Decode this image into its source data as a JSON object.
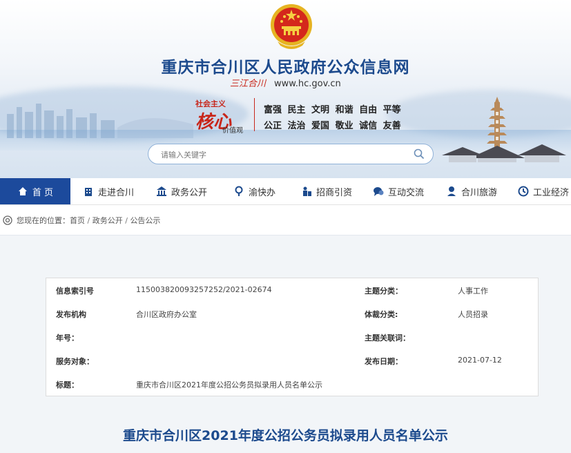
{
  "site": {
    "title": "重庆市合川区人民政府公众信息网",
    "calligraphy": "三江合川",
    "url": "www.hc.gov.cn"
  },
  "core_values": {
    "prefix": "社会主义",
    "big": "核心",
    "suffix": "价值观",
    "line1": "富强 民主 文明 和谐 自由 平等",
    "line2": "公正 法治 爱国 敬业 诚信 友善"
  },
  "search": {
    "placeholder": "请输入关键字",
    "icon": "search-icon"
  },
  "nav": {
    "items": [
      {
        "label": "首 页",
        "icon": "home-icon"
      },
      {
        "label": "走进合川",
        "icon": "building-icon"
      },
      {
        "label": "政务公开",
        "icon": "government-icon"
      },
      {
        "label": "渝快办",
        "icon": "service-icon"
      },
      {
        "label": "招商引资",
        "icon": "investment-icon"
      },
      {
        "label": "互动交流",
        "icon": "chat-icon"
      },
      {
        "label": "合川旅游",
        "icon": "travel-icon"
      },
      {
        "label": "工业经济",
        "icon": "industry-icon"
      }
    ]
  },
  "breadcrumb": {
    "prefix": "您现在的位置：",
    "items": [
      "首页",
      "政务公开",
      "公告公示"
    ],
    "separator": "/"
  },
  "meta": {
    "index_label": "信息索引号",
    "index_value": "11500382009325725 2/2021-02674",
    "theme_label": "主题分类：",
    "theme_value": "人事工作",
    "org_label": "发布机构",
    "org_value": "合川区政府办公室",
    "genre_label": "体裁分类:",
    "genre_value": "人员招录",
    "year_label": "年号：",
    "year_value": "",
    "keyword_label": "主题关联词：",
    "keyword_value": "",
    "target_label": "服务对象：",
    "target_value": "",
    "date_label": "发布日期：",
    "date_value": "2021-07-12",
    "subject_label": "标题：",
    "subject_value": "重庆市合川区2021年度公招公务员拟录用人员名单公示"
  },
  "article": {
    "title": "重庆市合川区2021年度公招公务员拟录用人员名单公示"
  },
  "colors": {
    "brand_blue": "#1c4a8d",
    "nav_active": "#1c4a9c",
    "accent_red": "#c8261a"
  }
}
